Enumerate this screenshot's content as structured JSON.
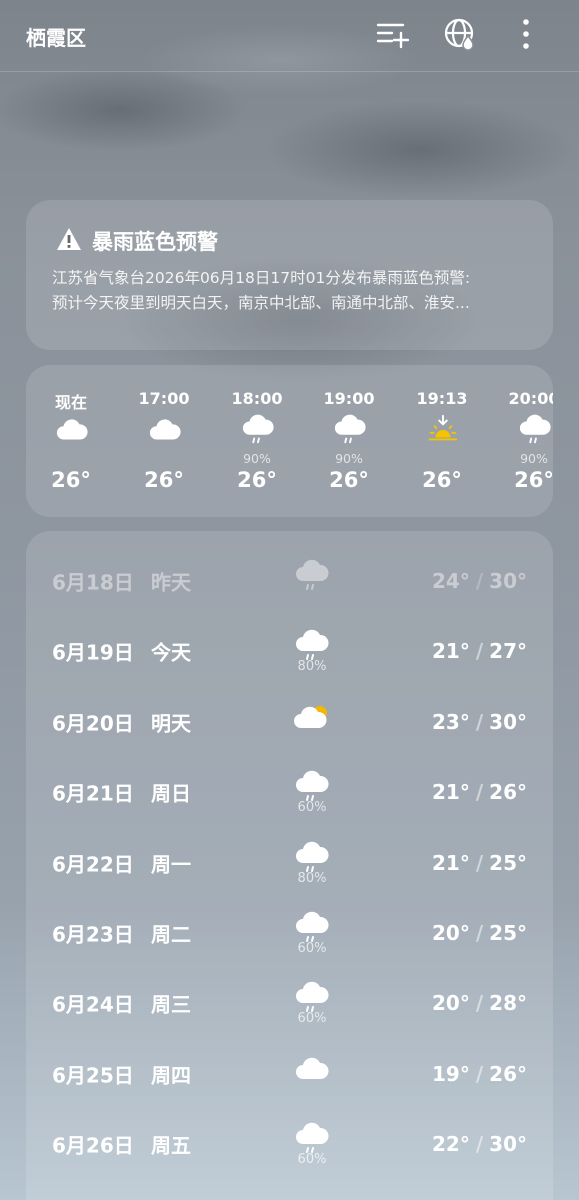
{
  "header": {
    "city": "栖霞区",
    "icons": [
      "add-list-icon",
      "globe-rain-icon",
      "more-icon"
    ]
  },
  "alert": {
    "icon": "warning-icon",
    "title": "暴雨蓝色预警",
    "line1": "江苏省气象台2026年06月18日17时01分发布暴雨蓝色预警:",
    "line2": "预计今天夜里到明天白天，南京中北部、南通中北部、淮安..."
  },
  "hourly": [
    {
      "time": "现在",
      "icon": "cloud-icon",
      "precip": "",
      "temp": "26°"
    },
    {
      "time": "17:00",
      "icon": "cloud-icon",
      "precip": "",
      "temp": "26°"
    },
    {
      "time": "18:00",
      "icon": "rain-icon",
      "precip": "90%",
      "temp": "26°"
    },
    {
      "time": "19:00",
      "icon": "rain-icon",
      "precip": "90%",
      "temp": "26°"
    },
    {
      "time": "19:13",
      "icon": "sunset-icon",
      "precip": "",
      "temp": "26°"
    },
    {
      "time": "20:00",
      "icon": "rain-icon",
      "precip": "90%",
      "temp": "26°"
    }
  ],
  "daily": [
    {
      "date": "6月18日",
      "weekday": "昨天",
      "icon": "rain-icon",
      "precip": "",
      "low": "24°",
      "high": "30°"
    },
    {
      "date": "6月19日",
      "weekday": "今天",
      "icon": "rain-icon",
      "precip": "80%",
      "low": "21°",
      "high": "27°"
    },
    {
      "date": "6月20日",
      "weekday": "明天",
      "icon": "partly-cloudy-icon",
      "precip": "",
      "low": "23°",
      "high": "30°"
    },
    {
      "date": "6月21日",
      "weekday": "周日",
      "icon": "rain-icon",
      "precip": "60%",
      "low": "21°",
      "high": "26°"
    },
    {
      "date": "6月22日",
      "weekday": "周一",
      "icon": "rain-icon",
      "precip": "80%",
      "low": "21°",
      "high": "25°"
    },
    {
      "date": "6月23日",
      "weekday": "周二",
      "icon": "rain-icon",
      "precip": "60%",
      "low": "20°",
      "high": "25°"
    },
    {
      "date": "6月24日",
      "weekday": "周三",
      "icon": "rain-icon",
      "precip": "60%",
      "low": "20°",
      "high": "28°"
    },
    {
      "date": "6月25日",
      "weekday": "周四",
      "icon": "cloud-icon",
      "precip": "",
      "low": "19°",
      "high": "26°"
    },
    {
      "date": "6月26日",
      "weekday": "周五",
      "icon": "rain-icon",
      "precip": "60%",
      "low": "22°",
      "high": "30°"
    }
  ]
}
